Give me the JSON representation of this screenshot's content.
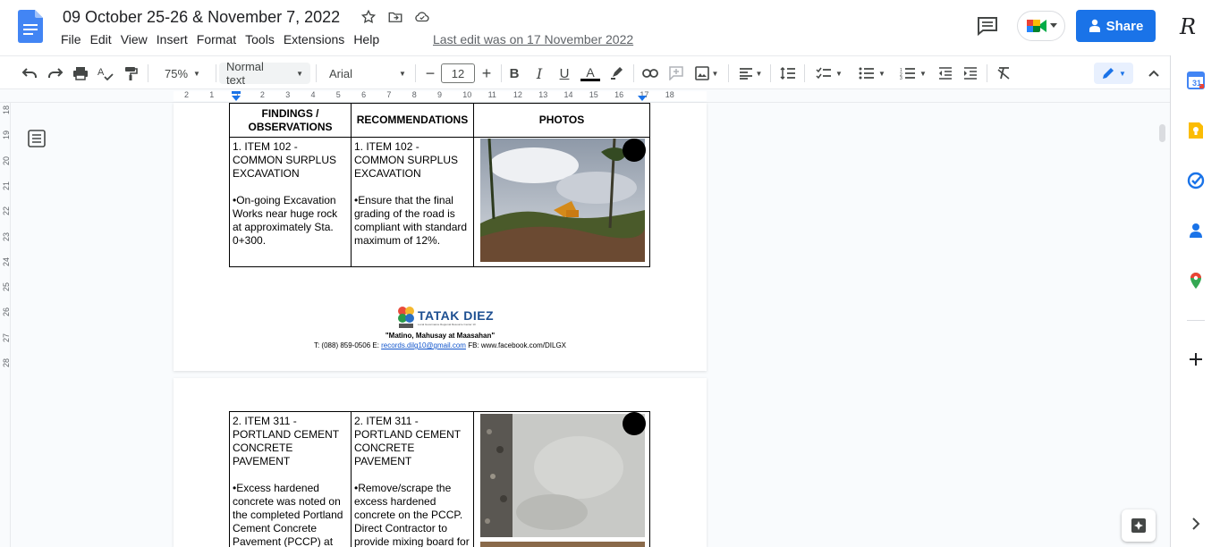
{
  "app": {
    "title": "09 October 25-26 & November 7, 2022",
    "last_edit": "Last edit was on 17 November 2022",
    "share_label": "Share",
    "avatar_initial": "R"
  },
  "menu": [
    "File",
    "Edit",
    "View",
    "Insert",
    "Format",
    "Tools",
    "Extensions",
    "Help"
  ],
  "toolbar": {
    "zoom": "75%",
    "style": "Normal text",
    "font": "Arial",
    "font_size": "12"
  },
  "ruler": {
    "h_ticks": [
      "2",
      "1",
      "1",
      "2",
      "3",
      "4",
      "5",
      "6",
      "7",
      "8",
      "9",
      "10",
      "11",
      "12",
      "13",
      "14",
      "15",
      "16",
      "17",
      "18"
    ],
    "v_ticks": [
      "18",
      "19",
      "20",
      "21",
      "22",
      "23",
      "24",
      "25",
      "26",
      "27",
      "28"
    ]
  },
  "table1": {
    "headers": [
      "FINDINGS / OBSERVATIONS",
      "RECOMMENDATIONS",
      "PHOTOS"
    ],
    "row": {
      "finding_title": "1. ITEM 102 - COMMON SURPLUS EXCAVATION",
      "finding_body": "•On-going Excavation Works near huge rock at approximately Sta. 0+300.",
      "rec_title": "1. ITEM 102 - COMMON SURPLUS EXCAVATION",
      "rec_body": "•Ensure that the final grading of the road is compliant with standard maximum of 12%."
    }
  },
  "footer": {
    "logo_text": "TATAK DIEZ",
    "logo_sub": "Local Governance Regional Resource Center 10",
    "motto": "\"Matino, Mahusay at Maasahan\"",
    "contact_prefix": "T: (088) 859-0506 E: ",
    "email": "records.dilg10@gmail.com",
    "contact_suffix": " FB: www.facebook.com/DILGX"
  },
  "table2": {
    "finding_title": "2. ITEM 311 - PORTLAND CEMENT CONCRETE PAVEMENT",
    "finding_body": "•Excess hardened concrete was noted on the completed Portland Cement Concrete Pavement (PCCP) at",
    "rec_title": "2. ITEM 311 - PORTLAND CEMENT CONCRETE PAVEMENT",
    "rec_body": "•Remove/scrape the excess hardened concrete on the PCCP. Direct Contractor to provide mixing board for"
  },
  "colors": {
    "brand_blue": "#1a73e8",
    "docs_blue": "#4285f4"
  }
}
